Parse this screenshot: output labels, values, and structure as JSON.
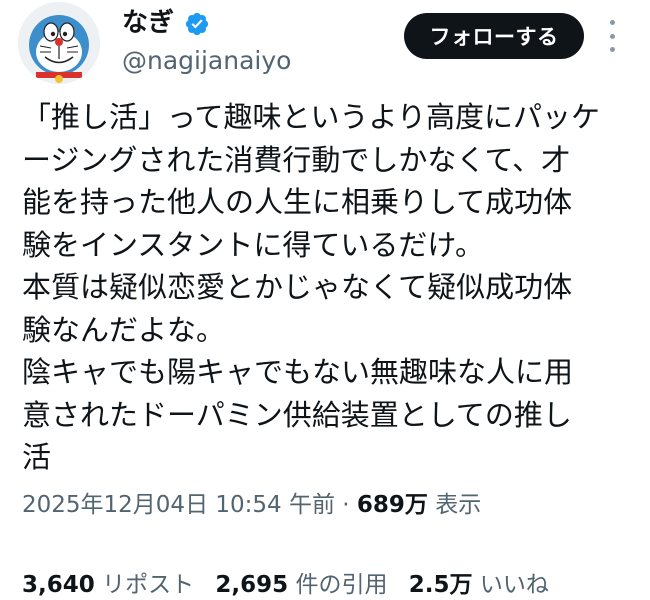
{
  "user": {
    "display_name": "なぎ",
    "handle": "@nagijanaiyo"
  },
  "follow_button_label": "フォローする",
  "tweet": {
    "lines": [
      "「推し活」って趣味というより高度にパッケ",
      "ージングされた消費行動でしかなくて、才",
      "能を持った他人の人生に相乗りして成功体",
      "験をインスタントに得ているだけ。",
      "本質は疑似恋愛とかじゃなくて疑似成功体",
      "験なんだよな。",
      "陰キャでも陽キャでもない無趣味な人に用",
      "意されたドーパミン供給装置としての推し",
      "活"
    ]
  },
  "meta": {
    "timestamp": "2025年12月04日 10:54 午前",
    "separator": "·",
    "views_count": "689万",
    "views_label": "表示"
  },
  "stats": {
    "reposts_count": "3,640",
    "reposts_label": "リポスト",
    "quotes_count": "2,695",
    "quotes_label": "件の引用",
    "likes_count": "2.5万",
    "likes_label": "いいね"
  },
  "colors": {
    "text": "#0f1419",
    "secondary": "#536471",
    "verified": "#1d9bf0",
    "button_bg": "#0f1419"
  },
  "icons": {
    "verified": "verified-badge-icon",
    "more": "more-options-icon"
  }
}
